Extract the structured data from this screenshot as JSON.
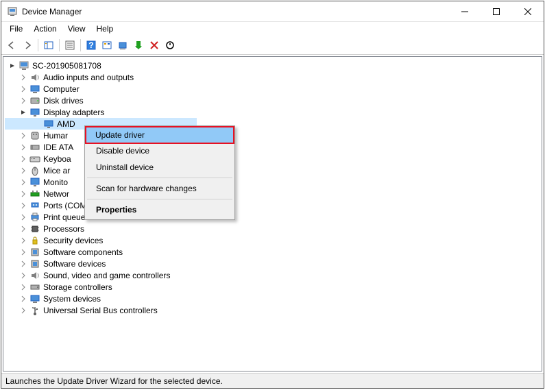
{
  "window": {
    "title": "Device Manager"
  },
  "menubar": [
    "File",
    "Action",
    "View",
    "Help"
  ],
  "tree": {
    "root": "SC-201905081708",
    "nodes": [
      {
        "label": "Audio inputs and outputs",
        "icon": "audio",
        "expanded": false
      },
      {
        "label": "Computer",
        "icon": "computer",
        "expanded": false
      },
      {
        "label": "Disk drives",
        "icon": "disk",
        "expanded": false
      },
      {
        "label": "Display adapters",
        "icon": "display",
        "expanded": true,
        "children": [
          {
            "label": "AMD",
            "icon": "display",
            "selected": true
          }
        ]
      },
      {
        "label": "Human Interface Devices",
        "icon": "hid",
        "expanded": false,
        "truncated": "Humar"
      },
      {
        "label": "IDE ATA/ATAPI controllers",
        "icon": "ide",
        "expanded": false,
        "truncated": "IDE ATA"
      },
      {
        "label": "Keyboards",
        "icon": "keyboard",
        "expanded": false,
        "truncated": "Keyboa"
      },
      {
        "label": "Mice and other pointing devices",
        "icon": "mouse",
        "expanded": false,
        "truncated": "Mice ar"
      },
      {
        "label": "Monitors",
        "icon": "monitor",
        "expanded": false,
        "truncated": "Monito"
      },
      {
        "label": "Network adapters",
        "icon": "network",
        "expanded": false,
        "truncated": "Networ"
      },
      {
        "label": "Ports (COM & LPT)",
        "icon": "ports",
        "expanded": false
      },
      {
        "label": "Print queues",
        "icon": "print",
        "expanded": false
      },
      {
        "label": "Processors",
        "icon": "cpu",
        "expanded": false
      },
      {
        "label": "Security devices",
        "icon": "security",
        "expanded": false
      },
      {
        "label": "Software components",
        "icon": "software",
        "expanded": false
      },
      {
        "label": "Software devices",
        "icon": "software",
        "expanded": false
      },
      {
        "label": "Sound, video and game controllers",
        "icon": "sound",
        "expanded": false
      },
      {
        "label": "Storage controllers",
        "icon": "storage",
        "expanded": false
      },
      {
        "label": "System devices",
        "icon": "system",
        "expanded": false
      },
      {
        "label": "Universal Serial Bus controllers",
        "icon": "usb",
        "expanded": false
      }
    ]
  },
  "context_menu": {
    "items": [
      {
        "label": "Update driver",
        "highlighted": true
      },
      {
        "label": "Disable device"
      },
      {
        "label": "Uninstall device"
      },
      {
        "sep": true
      },
      {
        "label": "Scan for hardware changes"
      },
      {
        "sep": true
      },
      {
        "label": "Properties",
        "bold": true
      }
    ]
  },
  "statusbar": "Launches the Update Driver Wizard for the selected device."
}
